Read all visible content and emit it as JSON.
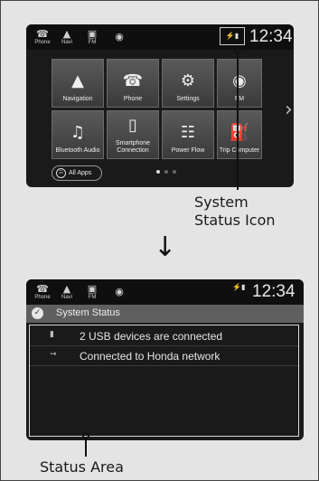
{
  "home_screen": {
    "statusbar": {
      "shortcuts": [
        {
          "label": "Phone",
          "icon": "phone-icon",
          "glyph": "☎"
        },
        {
          "label": "Navi",
          "icon": "compass-icon",
          "glyph": "▲"
        },
        {
          "label": "FM",
          "icon": "radio-icon",
          "glyph": "▣"
        },
        {
          "label": "",
          "icon": "broadcast-icon",
          "glyph": "◉"
        }
      ],
      "system_icon_text": "⚡▮",
      "clock": "12:34"
    },
    "tiles": [
      {
        "label": "Navigation",
        "icon": "navigation-icon",
        "glyph": "▲"
      },
      {
        "label": "Phone",
        "icon": "phone-icon",
        "glyph": "☎"
      },
      {
        "label": "Settings",
        "icon": "gear-icon",
        "glyph": "⚙"
      },
      {
        "label": "FM",
        "icon": "radio-icon",
        "glyph": "◉"
      },
      {
        "label": "Bluetooth Audio",
        "icon": "bluetooth-icon",
        "glyph": "♫"
      },
      {
        "label": "Smartphone Connection",
        "icon": "smartphone-icon",
        "glyph": "▯"
      },
      {
        "label": "Power Flow",
        "icon": "power-flow-icon",
        "glyph": "☷"
      },
      {
        "label": "Trip Computer",
        "icon": "fuel-icon",
        "glyph": "⛽"
      }
    ],
    "all_apps_label": "All Apps",
    "page_dots": 3,
    "active_page": 1
  },
  "callouts": {
    "system_status_icon": "System Status Icon",
    "status_area": "Status Area"
  },
  "status_screen": {
    "clock": "12:34",
    "header": "System Status",
    "rows": [
      {
        "icon": "usb-icon",
        "glyph": "▮",
        "text": "2 USB devices are connected"
      },
      {
        "icon": "wifi-icon",
        "glyph": "⇝",
        "text": "Connected to Honda network"
      }
    ]
  }
}
